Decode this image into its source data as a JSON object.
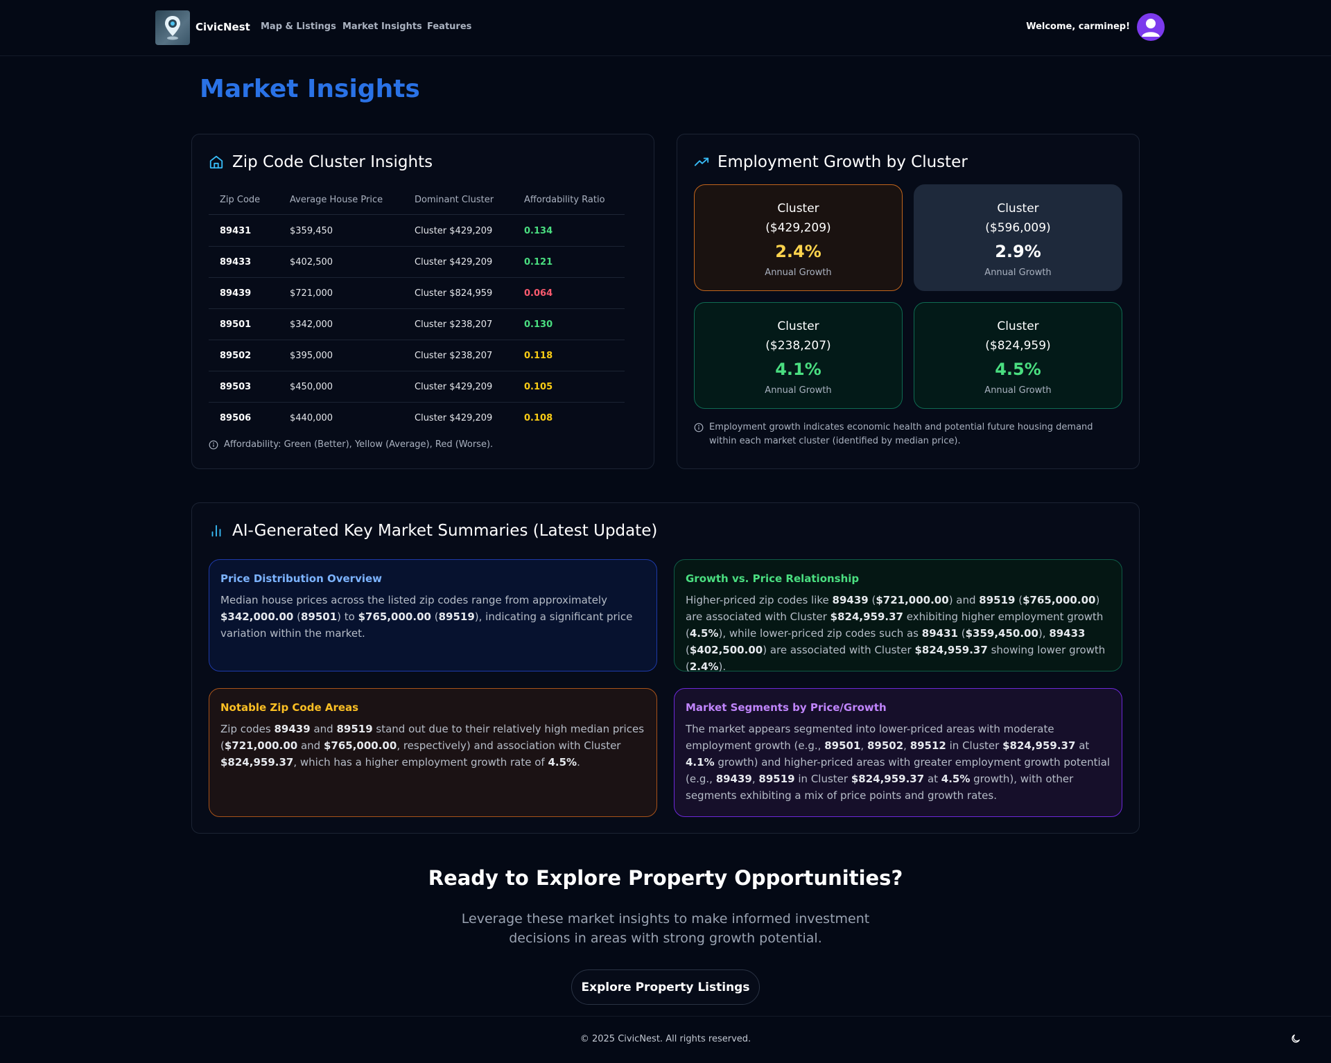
{
  "nav": {
    "brand": "CivicNest",
    "links": [
      "Map & Listings",
      "Market Insights",
      "Features"
    ],
    "welcome": "Welcome, carminep!"
  },
  "page_title": "Market Insights",
  "zip_card": {
    "title": "Zip Code Cluster Insights",
    "columns": [
      "Zip Code",
      "Average House Price",
      "Dominant Cluster",
      "Affordability Ratio"
    ],
    "rows": [
      {
        "zip": "89431",
        "price": "$359,450",
        "cluster": "Cluster $429,209",
        "ratio": "0.134",
        "level": "green"
      },
      {
        "zip": "89433",
        "price": "$402,500",
        "cluster": "Cluster $429,209",
        "ratio": "0.121",
        "level": "green"
      },
      {
        "zip": "89439",
        "price": "$721,000",
        "cluster": "Cluster $824,959",
        "ratio": "0.064",
        "level": "red"
      },
      {
        "zip": "89501",
        "price": "$342,000",
        "cluster": "Cluster $238,207",
        "ratio": "0.130",
        "level": "green"
      },
      {
        "zip": "89502",
        "price": "$395,000",
        "cluster": "Cluster $238,207",
        "ratio": "0.118",
        "level": "yellow"
      },
      {
        "zip": "89503",
        "price": "$450,000",
        "cluster": "Cluster $429,209",
        "ratio": "0.105",
        "level": "yellow"
      },
      {
        "zip": "89506",
        "price": "$440,000",
        "cluster": "Cluster $429,209",
        "ratio": "0.108",
        "level": "yellow"
      }
    ],
    "note": "Affordability: Green (Better), Yellow (Average), Red (Worse)."
  },
  "employment_card": {
    "title": "Employment Growth by Cluster",
    "tiles": [
      {
        "line1": "Cluster",
        "line2": "($429,209)",
        "value": "2.4%",
        "label": "Annual Growth",
        "theme": "orange"
      },
      {
        "line1": "Cluster",
        "line2": "($596,009)",
        "value": "2.9%",
        "label": "Annual Growth",
        "theme": "slate"
      },
      {
        "line1": "Cluster",
        "line2": "($238,207)",
        "value": "4.1%",
        "label": "Annual Growth",
        "theme": "green"
      },
      {
        "line1": "Cluster",
        "line2": "($824,959)",
        "value": "4.5%",
        "label": "Annual Growth",
        "theme": "green"
      }
    ],
    "note": "Employment growth indicates economic health and potential future housing demand within each market cluster (identified by median price)."
  },
  "summaries_card": {
    "title": "AI-Generated Key Market Summaries (Latest Update)",
    "items": [
      {
        "title": "Price Distribution Overview",
        "theme": "blue",
        "parts": [
          {
            "t": "Median house prices across the listed zip codes range from approximately "
          },
          {
            "t": "$342,000.00",
            "b": true
          },
          {
            "t": " ("
          },
          {
            "t": "89501",
            "b": true
          },
          {
            "t": ") to "
          },
          {
            "t": "$765,000.00",
            "b": true
          },
          {
            "t": " ("
          },
          {
            "t": "89519",
            "b": true
          },
          {
            "t": "), indicating a significant price variation within the market."
          }
        ]
      },
      {
        "title": "Growth vs. Price Relationship",
        "theme": "green",
        "parts": [
          {
            "t": "Higher-priced zip codes like "
          },
          {
            "t": "89439",
            "b": true
          },
          {
            "t": " ("
          },
          {
            "t": "$721,000.00",
            "b": true
          },
          {
            "t": ") and "
          },
          {
            "t": "89519",
            "b": true
          },
          {
            "t": " ("
          },
          {
            "t": "$765,000.00",
            "b": true
          },
          {
            "t": ") are associated with Cluster "
          },
          {
            "t": "$824,959.37",
            "b": true
          },
          {
            "t": " exhibiting higher employment growth ("
          },
          {
            "t": "4.5%",
            "b": true
          },
          {
            "t": "), while lower-priced zip codes such as "
          },
          {
            "t": "89431",
            "b": true
          },
          {
            "t": " ("
          },
          {
            "t": "$359,450.00",
            "b": true
          },
          {
            "t": "), "
          },
          {
            "t": "89433",
            "b": true
          },
          {
            "t": " ("
          },
          {
            "t": "$402,500.00",
            "b": true
          },
          {
            "t": ") are associated with Cluster "
          },
          {
            "t": "$824,959.37",
            "b": true
          },
          {
            "t": " showing lower growth ("
          },
          {
            "t": "2.4%",
            "b": true
          },
          {
            "t": ")."
          }
        ]
      },
      {
        "title": "Notable Zip Code Areas",
        "theme": "orange",
        "parts": [
          {
            "t": "Zip codes "
          },
          {
            "t": "89439",
            "b": true
          },
          {
            "t": " and "
          },
          {
            "t": "89519",
            "b": true
          },
          {
            "t": " stand out due to their relatively high median prices ("
          },
          {
            "t": "$721,000.00",
            "b": true
          },
          {
            "t": " and "
          },
          {
            "t": "$765,000.00",
            "b": true
          },
          {
            "t": ", respectively) and association with Cluster "
          },
          {
            "t": "$824,959.37",
            "b": true
          },
          {
            "t": ", which has a higher employment growth rate of "
          },
          {
            "t": "4.5%",
            "b": true
          },
          {
            "t": "."
          }
        ]
      },
      {
        "title": "Market Segments by Price/Growth",
        "theme": "purple",
        "parts": [
          {
            "t": "The market appears segmented into lower-priced areas with moderate employment growth (e.g., "
          },
          {
            "t": "89501",
            "b": true
          },
          {
            "t": ", "
          },
          {
            "t": "89502",
            "b": true
          },
          {
            "t": ", "
          },
          {
            "t": "89512",
            "b": true
          },
          {
            "t": " in Cluster "
          },
          {
            "t": "$824,959.37",
            "b": true
          },
          {
            "t": " at "
          },
          {
            "t": "4.1%",
            "b": true
          },
          {
            "t": " growth) and higher-priced areas with greater employment growth potential (e.g., "
          },
          {
            "t": "89439",
            "b": true
          },
          {
            "t": ", "
          },
          {
            "t": "89519",
            "b": true
          },
          {
            "t": " in Cluster "
          },
          {
            "t": "$824,959.37",
            "b": true
          },
          {
            "t": " at "
          },
          {
            "t": "4.5%",
            "b": true
          },
          {
            "t": " growth), with other segments exhibiting a mix of price points and growth rates."
          }
        ]
      }
    ]
  },
  "cta": {
    "title": "Ready to Explore Property Opportunities?",
    "text": "Leverage these market insights to make informed investment decisions in areas with strong growth potential.",
    "button": "Explore Property Listings"
  },
  "footer": {
    "text": "© 2025 CivicNest. All rights reserved."
  },
  "colors": {
    "title_blue": "#2a72e6",
    "ratio_green": "#4ade80",
    "ratio_yellow": "#facc15",
    "ratio_red": "#fb5a6e",
    "icon_cyan": "#38bdf8"
  },
  "icons": [
    "map-pin-icon",
    "user-avatar-icon",
    "home-icon",
    "trending-up-icon",
    "info-icon",
    "bar-chart-icon",
    "moon-icon"
  ]
}
